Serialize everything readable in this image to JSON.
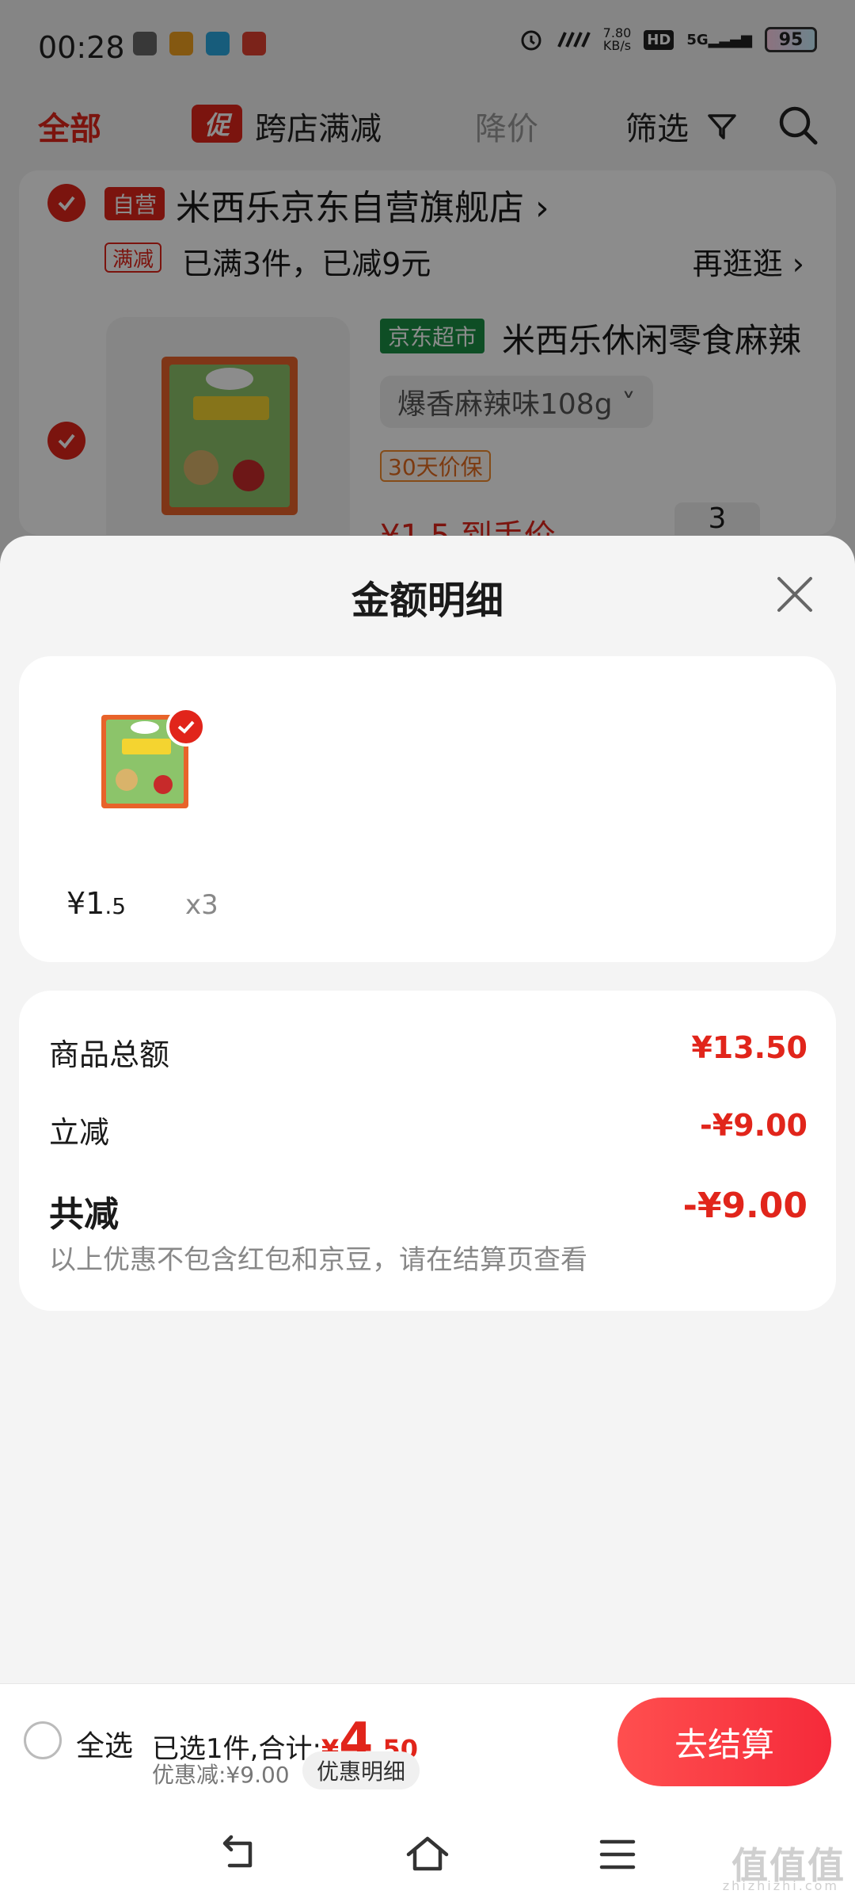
{
  "status_bar": {
    "time": "00:28",
    "net_speed_value": "7.80",
    "net_speed_unit": "KB/s",
    "hd_label": "HD",
    "signal_label": "5G",
    "battery": "95"
  },
  "top_nav": {
    "all_tab": "全部",
    "promo_tag": "促",
    "cross_store": "跨店满减",
    "price_drop": "降价",
    "filter": "筛选"
  },
  "store": {
    "self_tag": "自营",
    "name": "米西乐京东自营旗舰店 ›",
    "promo_tag": "满减",
    "promo_text": "已满3件，已减9元",
    "browse_more": "再逛逛 ›"
  },
  "product": {
    "market_tag": "京东超市",
    "title": "米西乐休闲零食麻辣",
    "sku": "爆香麻辣味108g ˅",
    "guarantee": "30天价保",
    "price_peek": "¥1.5 到手价",
    "qty_peek": "3"
  },
  "sheet": {
    "title": "金额明细",
    "item": {
      "price_main": "¥1",
      "price_dec": ".5",
      "qty": "x3"
    },
    "summary": {
      "goods_total_label": "商品总额",
      "goods_total_value": "¥13.50",
      "instant_off_label": "立减",
      "instant_off_value": "-¥9.00",
      "total_off_label": "共减",
      "total_off_value": "-¥9.00",
      "note": "以上优惠不包含红包和京豆，请在结算页查看"
    }
  },
  "bottom_bar": {
    "select_all": "全选",
    "selected_prefix": "已选1件,合计:",
    "total_symbol": "¥",
    "total_int": "4",
    "total_dec": ".50",
    "discount_text": "优惠减:¥9.00",
    "discount_detail": "优惠明细",
    "checkout": "去结算"
  },
  "watermark": {
    "main": "值值值",
    "sub": "zhizhizhi.com"
  },
  "colors": {
    "accent": "#e1251b",
    "jd_market_green": "#1a8f44",
    "guarantee_orange": "#e26b1e"
  }
}
